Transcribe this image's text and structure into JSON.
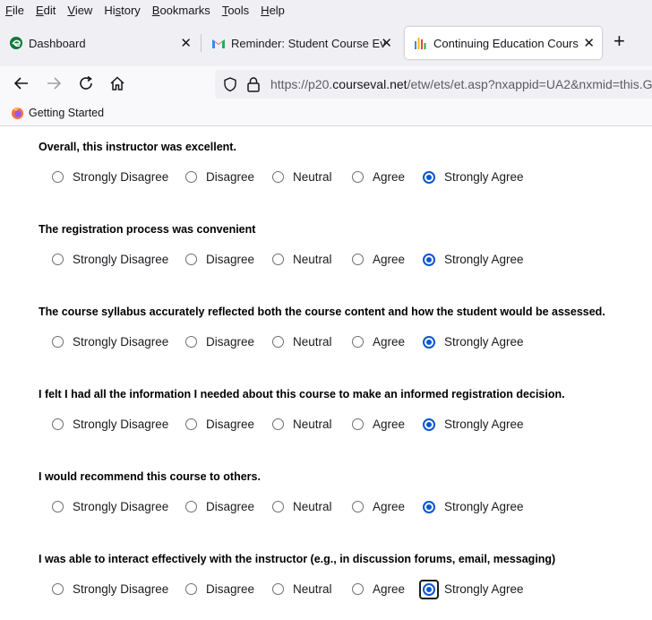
{
  "menu": [
    "File",
    "Edit",
    "View",
    "History",
    "Bookmarks",
    "Tools",
    "Help"
  ],
  "menu_underline": [
    "F",
    "E",
    "V",
    "s",
    "B",
    "T",
    "H"
  ],
  "tabs": [
    {
      "title": "Dashboard"
    },
    {
      "title": "Reminder: Student Course Evalu"
    },
    {
      "title": "Continuing Education Course E"
    }
  ],
  "url": {
    "prefix": "https://p20.",
    "domain": "courseval.net",
    "rest": "/etw/ets/et.asp?nxappid=UA2&nxmid=this.G"
  },
  "bookmarks": [
    {
      "label": "Getting Started"
    }
  ],
  "colors": {
    "accent": "#0b57d0",
    "chrome": "#f0f0f4"
  },
  "options": [
    "Strongly Disagree",
    "Disagree",
    "Neutral",
    "Agree",
    "Strongly Agree"
  ],
  "questions": [
    {
      "text": "Overall, this instructor was excellent.",
      "selected": "Strongly Agree"
    },
    {
      "text": "The registration process was convenient",
      "selected": "Strongly Agree"
    },
    {
      "text": "The course syllabus accurately reflected both the course content and how the student would be assessed.",
      "selected": "Strongly Agree"
    },
    {
      "text": "I felt I had all the information I needed about this course to make an informed registration decision.",
      "selected": "Strongly Agree"
    },
    {
      "text": "I would recommend this course to others.",
      "selected": "Strongly Agree"
    },
    {
      "text": "I was able to interact effectively with the instructor (e.g., in discussion forums, email, messaging)",
      "selected": "Strongly Agree"
    }
  ]
}
